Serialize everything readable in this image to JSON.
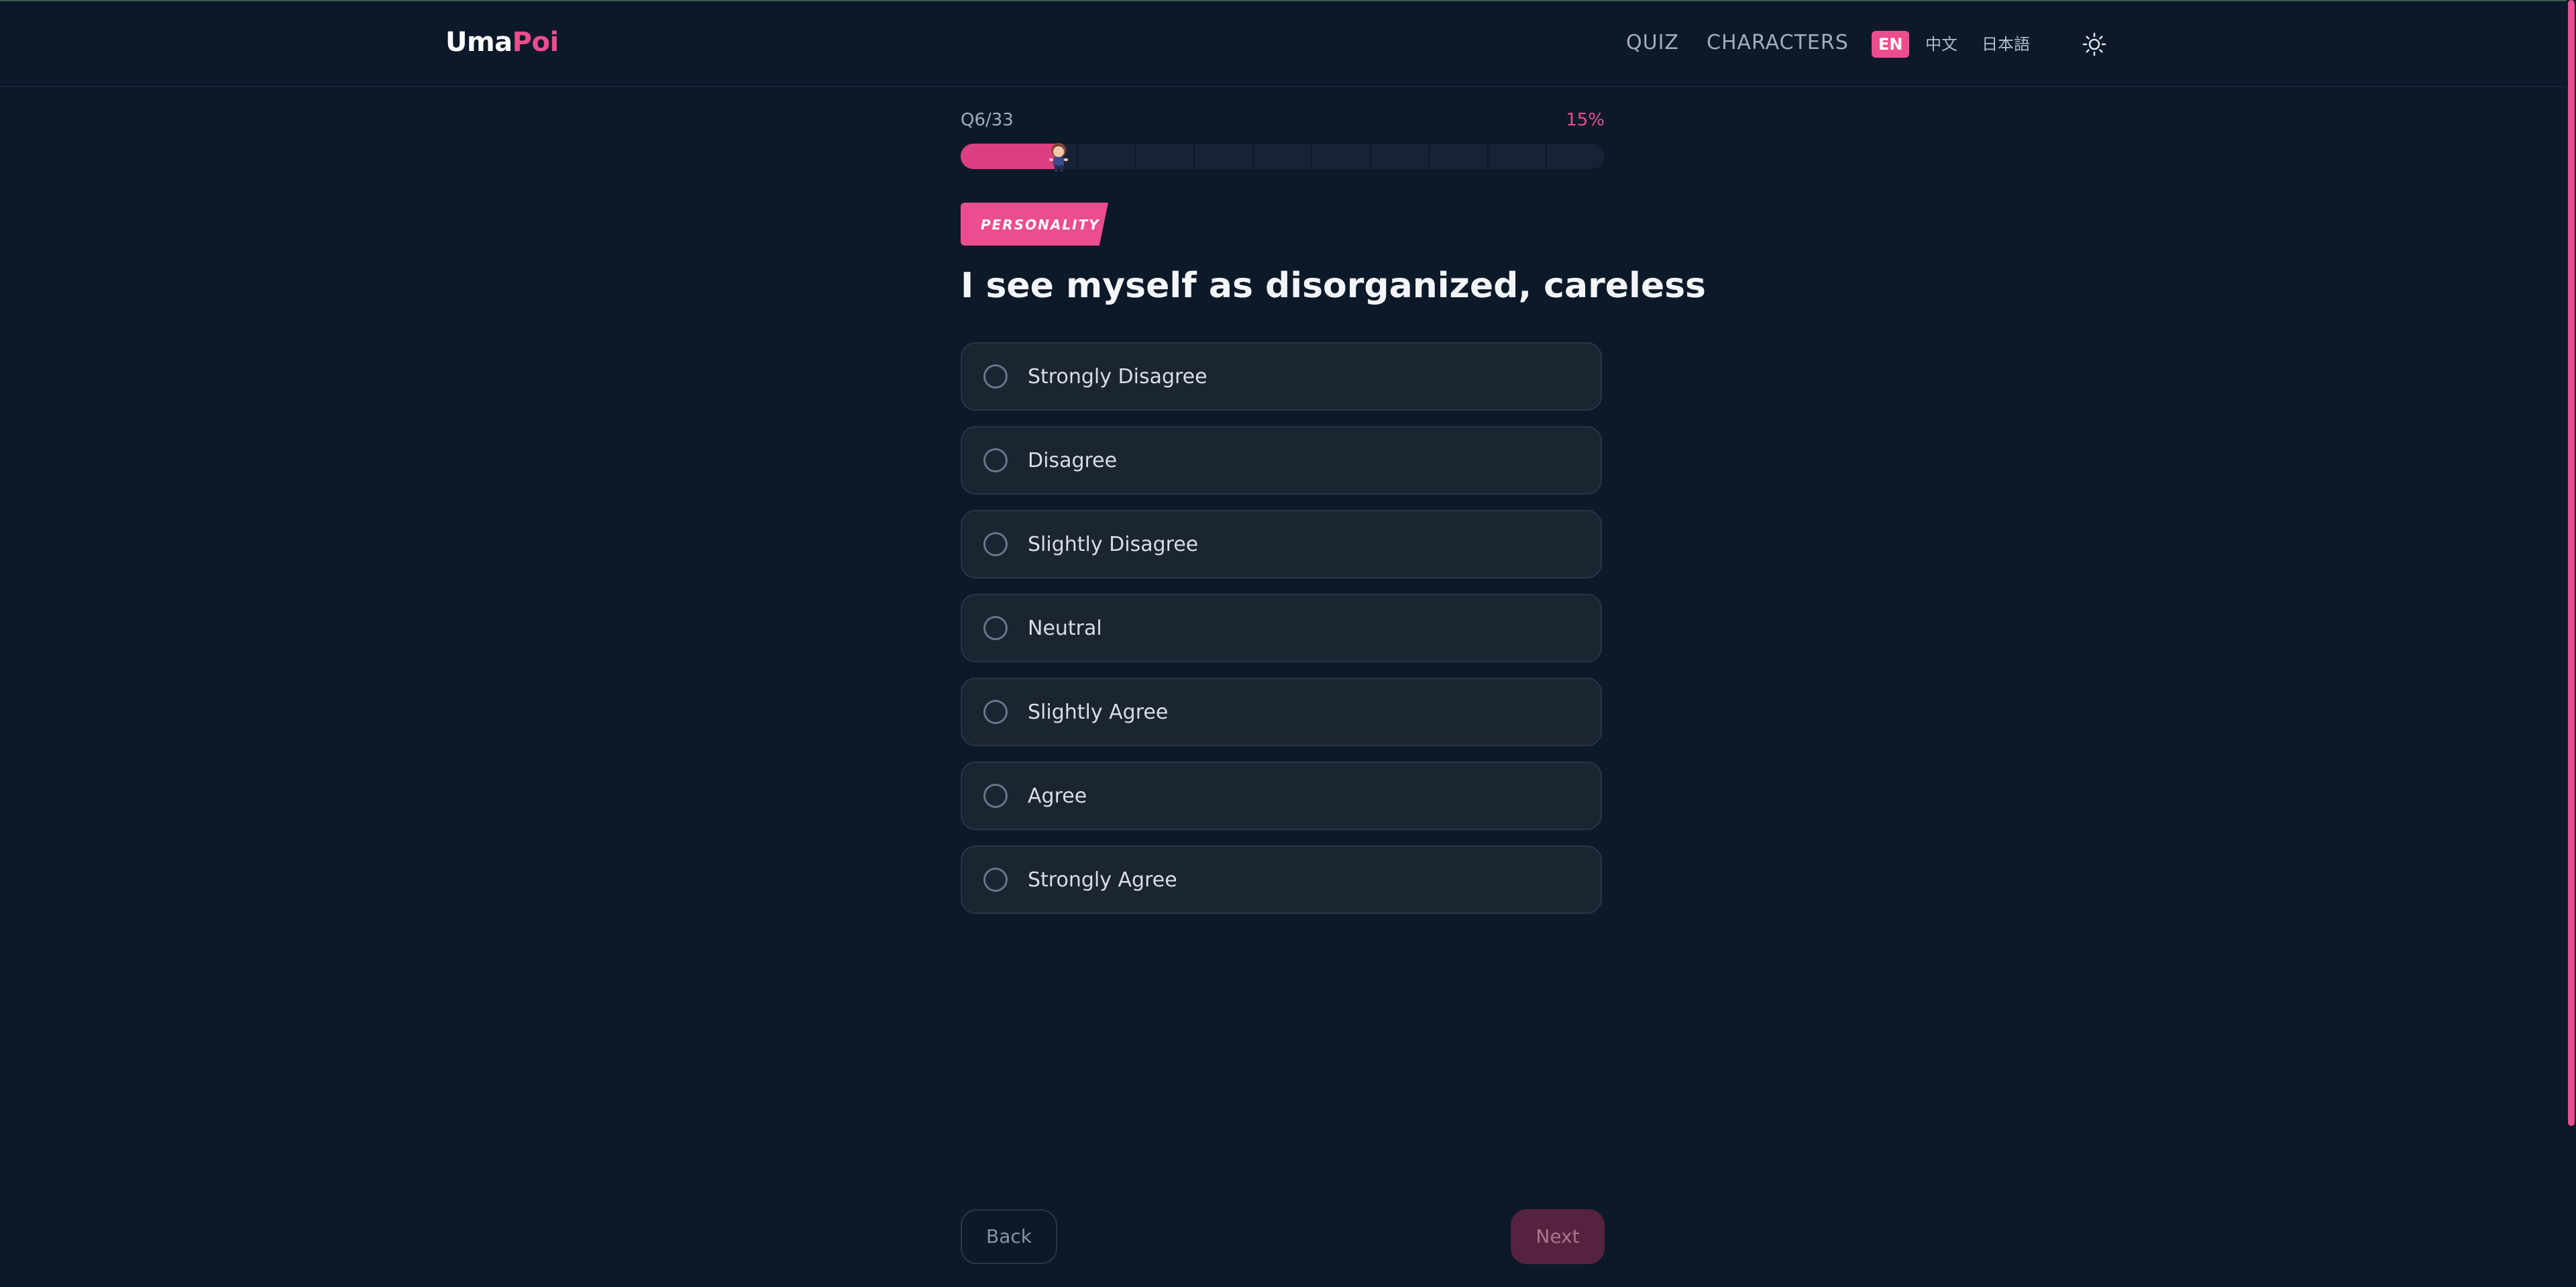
{
  "header": {
    "logo_part1": "Uma",
    "logo_part2": "Poi",
    "nav": {
      "quiz": "QUIZ",
      "characters": "CHARACTERS"
    },
    "languages": {
      "en": "EN",
      "zh": "中文",
      "ja": "日本語"
    },
    "theme_icon": "sun-icon"
  },
  "progress": {
    "counter": "Q6/33",
    "percent_text": "15%",
    "fraction": 0.15,
    "segments": 11,
    "runner_icon": "runner-character-icon"
  },
  "question": {
    "category": "PERSONALITY",
    "text": "I see myself as disorganized, careless",
    "options": [
      "Strongly Disagree",
      "Disagree",
      "Slightly Disagree",
      "Neutral",
      "Slightly Agree",
      "Agree",
      "Strongly Agree"
    ]
  },
  "footer": {
    "back": "Back",
    "next": "Next"
  },
  "colors": {
    "accent": "#ec4d8f",
    "background": "#0c1929",
    "option_bg": "#1b2431"
  }
}
